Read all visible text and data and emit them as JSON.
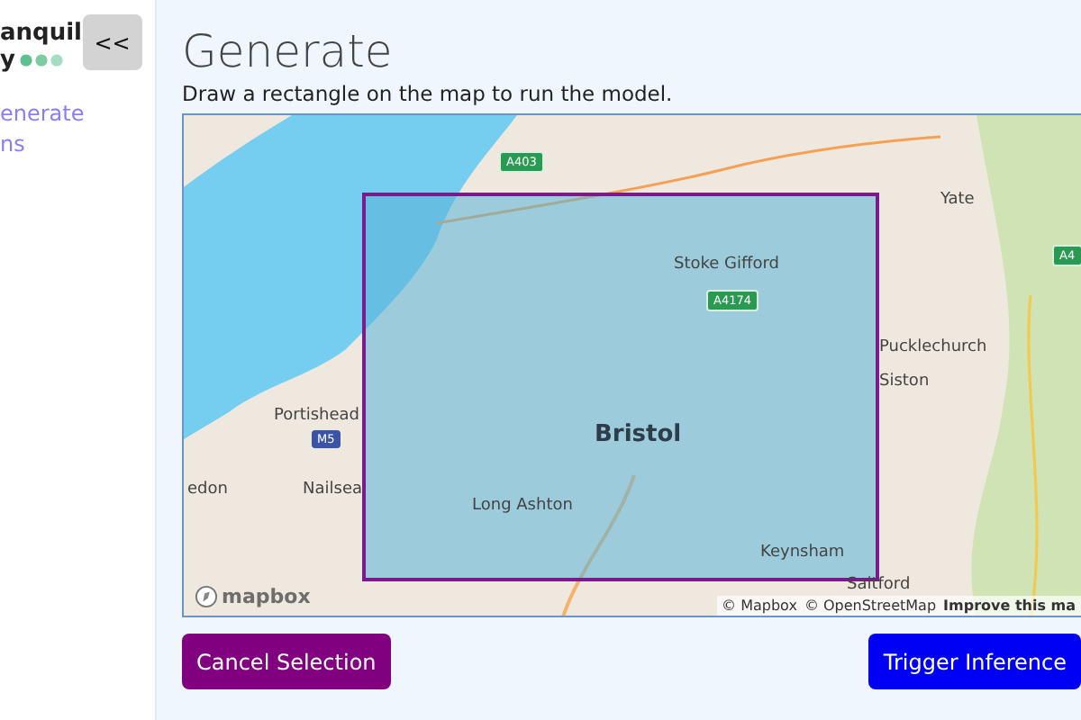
{
  "sidebar": {
    "logo": {
      "line_1": "anquil",
      "line_2": "y"
    },
    "collapse_button": "<<",
    "nav": [
      {
        "label": "enerate"
      },
      {
        "label": "ns"
      }
    ]
  },
  "main": {
    "title": "Generate",
    "instruction": "Draw a rectangle on the map to run the model.",
    "map": {
      "labels": [
        {
          "text": "A403",
          "kind": "road"
        },
        {
          "text": "Yate",
          "kind": "place"
        },
        {
          "text": "A4",
          "kind": "road"
        },
        {
          "text": "Stoke Gifford",
          "kind": "place"
        },
        {
          "text": "A4174",
          "kind": "road"
        },
        {
          "text": "Pucklechurch",
          "kind": "place"
        },
        {
          "text": "Portishead",
          "kind": "place"
        },
        {
          "text": "Siston",
          "kind": "place"
        },
        {
          "text": "M5",
          "kind": "motorway"
        },
        {
          "text": "Bristol",
          "kind": "city"
        },
        {
          "text": "edon",
          "kind": "place"
        },
        {
          "text": "Nailsea",
          "kind": "place"
        },
        {
          "text": "Long Ashton",
          "kind": "place"
        },
        {
          "text": "Keynsham",
          "kind": "place"
        },
        {
          "text": "Saltford",
          "kind": "place"
        }
      ],
      "selection_drawn": true,
      "logo": "mapbox",
      "attribution": [
        "© Mapbox",
        "© OpenStreetMap",
        "Improve this ma"
      ]
    },
    "buttons": [
      {
        "label": "Cancel Selection",
        "kind": "cancel"
      },
      {
        "label": "Trigger Inference",
        "kind": "primary"
      }
    ]
  }
}
